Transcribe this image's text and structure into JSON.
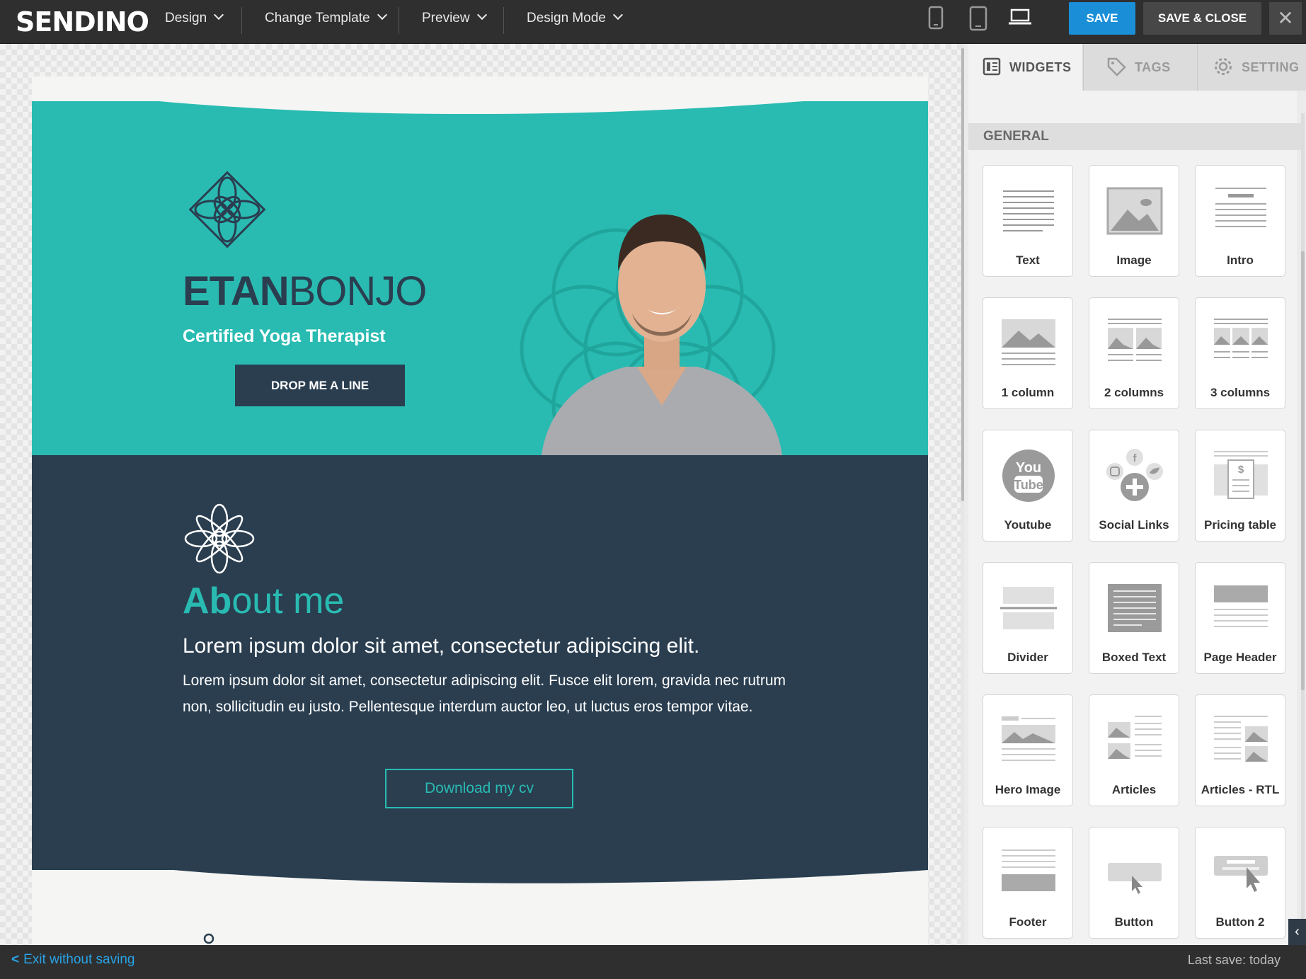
{
  "app": {
    "logo": "SENDINO"
  },
  "toolbar": {
    "menus": [
      {
        "label": "Design"
      },
      {
        "label": "Change Template"
      },
      {
        "label": "Preview"
      },
      {
        "label": "Design Mode"
      }
    ],
    "devices": [
      "phone-icon",
      "tablet-icon",
      "laptop-icon"
    ],
    "save_label": "SAVE",
    "save_close_label": "SAVE & CLOSE",
    "close_symbol": "✕"
  },
  "email": {
    "hero": {
      "brand_bold": "ETAN",
      "brand_light": "BONJO",
      "tagline": "Certified Yoga Therapist",
      "cta_label": "DROP ME A LINE"
    },
    "about": {
      "title_bold": "Ab",
      "title_light": "out me",
      "lead": "Lorem ipsum dolor sit amet, consectetur adipiscing elit.",
      "body": "Lorem ipsum dolor sit amet, consectetur adipiscing elit. Fusce elit lorem, gravida nec rutrum non, sollicitudin eu justo. Pellentesque interdum auctor leo, ut luctus eros tempor vitae.",
      "cv_label": "Download my cv"
    },
    "colors": {
      "teal": "#29bbb2",
      "navy": "#2a3e50"
    }
  },
  "panel": {
    "tabs": [
      {
        "label": "WIDGETS",
        "icon": "widgets-icon",
        "active": true
      },
      {
        "label": "TAGS",
        "icon": "tag-icon",
        "active": false
      },
      {
        "label": "SETTING",
        "icon": "gear-icon",
        "active": false
      }
    ],
    "section": "GENERAL",
    "widgets": [
      {
        "label": "Text",
        "icon": "text-widget-icon"
      },
      {
        "label": "Image",
        "icon": "image-widget-icon"
      },
      {
        "label": "Intro",
        "icon": "intro-widget-icon"
      },
      {
        "label": "1 column",
        "icon": "one-column-icon"
      },
      {
        "label": "2 columns",
        "icon": "two-columns-icon"
      },
      {
        "label": "3 columns",
        "icon": "three-columns-icon"
      },
      {
        "label": "Youtube",
        "icon": "youtube-icon"
      },
      {
        "label": "Social Links",
        "icon": "social-links-icon"
      },
      {
        "label": "Pricing table",
        "icon": "pricing-table-icon"
      },
      {
        "label": "Divider",
        "icon": "divider-icon"
      },
      {
        "label": "Boxed Text",
        "icon": "boxed-text-icon"
      },
      {
        "label": "Page Header",
        "icon": "page-header-icon"
      },
      {
        "label": "Hero Image",
        "icon": "hero-image-icon"
      },
      {
        "label": "Articles",
        "icon": "articles-icon"
      },
      {
        "label": "Articles - RTL",
        "icon": "articles-rtl-icon"
      },
      {
        "label": "Footer",
        "icon": "footer-icon"
      },
      {
        "label": "Button",
        "icon": "button-widget-icon"
      },
      {
        "label": "Button 2",
        "icon": "button2-widget-icon"
      }
    ]
  },
  "bottom": {
    "exit_label": "Exit without saving",
    "last_save": "Last save: today"
  }
}
